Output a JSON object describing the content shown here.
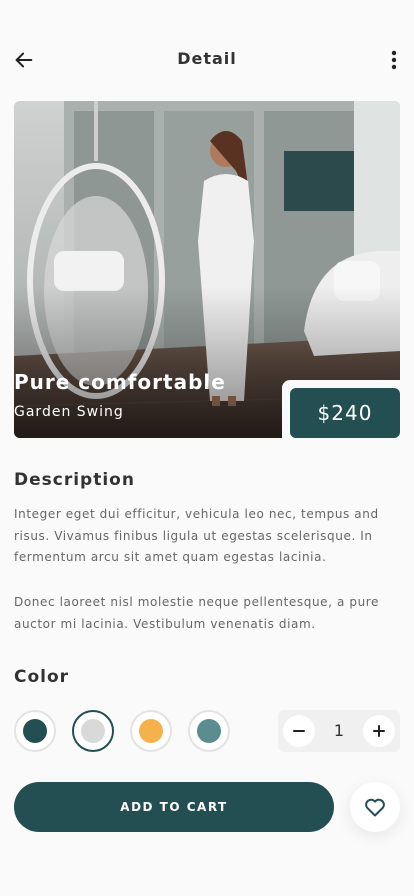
{
  "header": {
    "title": "Detail",
    "back_icon": "arrow-left-icon",
    "more_icon": "more-vertical-icon"
  },
  "product": {
    "name": "Pure comfortable",
    "subtitle": "Garden Swing",
    "price": "$240"
  },
  "description": {
    "heading": "Description",
    "paragraph_1": "Integer eget dui efficitur, vehicula leo nec, tempus and risus. Vivamus finibus ligula ut egestas scelerisque. In fermentum arcu sit amet quam egestas lacinia.",
    "paragraph_2": "Donec laoreet nisl molestie neque pellentesque, a pure auctor mi lacinia. Vestibulum venenatis diam."
  },
  "color": {
    "heading": "Color",
    "selected_index": 1,
    "swatches": [
      {
        "hex": "#234e52"
      },
      {
        "hex": "#d9d9d9"
      },
      {
        "hex": "#f5b14c"
      },
      {
        "hex": "#5a8c90"
      }
    ]
  },
  "quantity": {
    "value": "1",
    "minus_icon": "minus-icon",
    "plus_icon": "plus-icon"
  },
  "actions": {
    "add_to_cart_label": "ADD TO CART",
    "favorite_icon": "heart-icon"
  },
  "colors": {
    "accent": "#234e52",
    "background": "#fafafa"
  }
}
